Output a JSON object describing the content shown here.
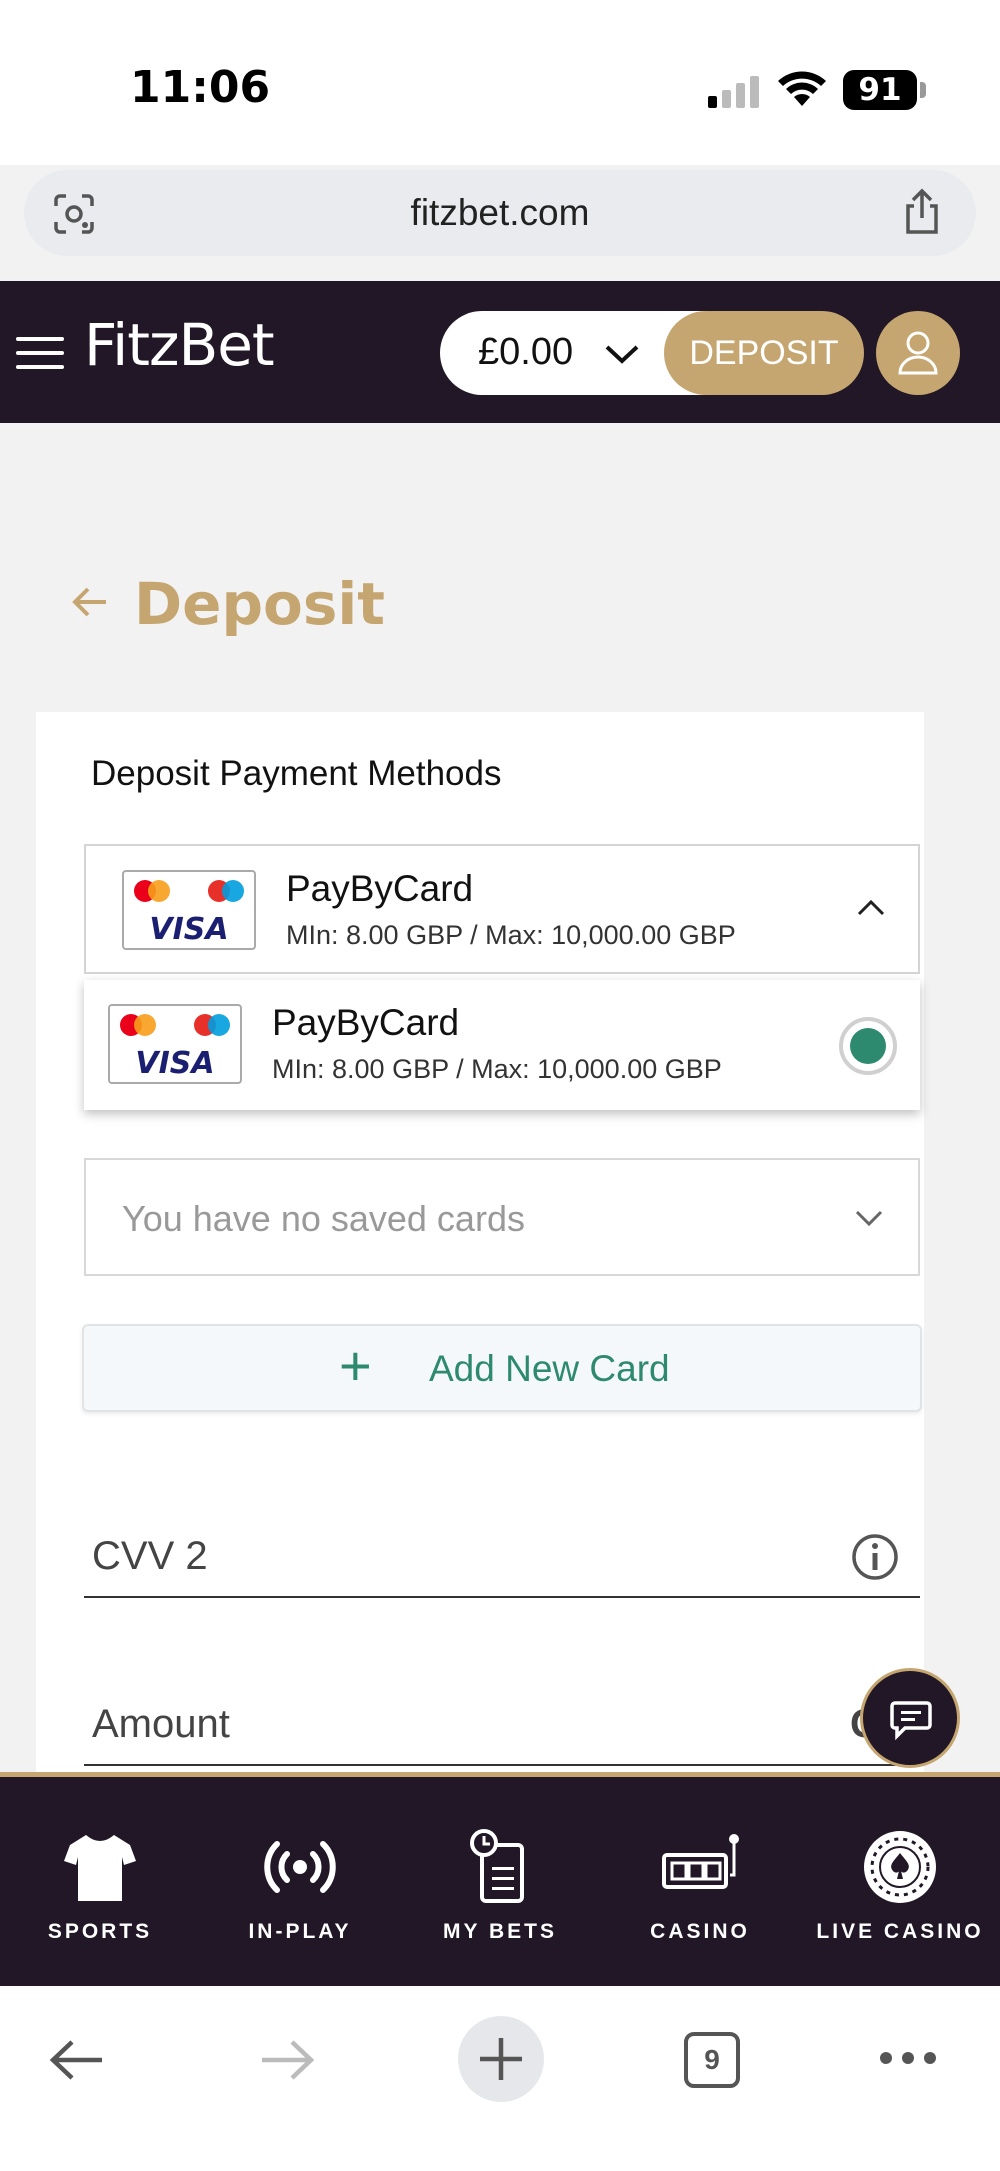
{
  "status": {
    "time": "11:06",
    "battery": "91"
  },
  "browser": {
    "url": "fitzbet.com",
    "tabs_count": "9"
  },
  "header": {
    "logo": "FitzBet",
    "balance": "£0.00",
    "deposit_label": "DEPOSIT"
  },
  "page": {
    "title": "Deposit"
  },
  "form": {
    "payment_methods_label": "Deposit Payment Methods",
    "selected_method": {
      "name": "PayByCard",
      "limits": "MIn: 8.00 GBP / Max: 10,000.00 GBP"
    },
    "options": [
      {
        "name": "PayByCard",
        "limits": "MIn: 8.00 GBP / Max: 10,000.00 GBP",
        "selected": true
      }
    ],
    "saved_cards_placeholder": "You have no saved cards",
    "add_card_label": "Add New Card",
    "cvv_label": "CVV 2",
    "amount_label": "Amount",
    "amount_currency": "GB"
  },
  "bottom_nav": [
    {
      "label": "SPORTS",
      "icon": "shirt-icon"
    },
    {
      "label": "IN-PLAY",
      "icon": "broadcast-icon"
    },
    {
      "label": "MY BETS",
      "icon": "betslip-icon"
    },
    {
      "label": "CASINO",
      "icon": "slot-machine-icon"
    },
    {
      "label": "LIVE CASINO",
      "icon": "roulette-icon"
    }
  ],
  "colors": {
    "brand_dark": "#211726",
    "gold": "#c6a670",
    "green": "#2e8a6e"
  }
}
